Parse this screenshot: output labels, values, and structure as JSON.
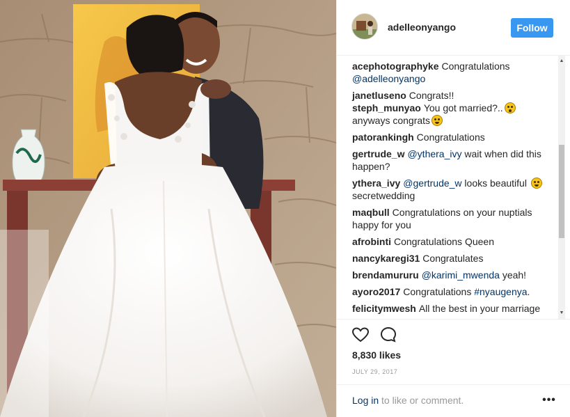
{
  "post": {
    "username": "adelleonyango",
    "follow_label": "Follow",
    "likes": "8,830 likes",
    "date": "JULY 29, 2017",
    "login_link": "Log in",
    "login_rest": " to like or comment.",
    "more_label": "•••"
  },
  "icons": {
    "like": "heart-icon",
    "comment": "comment-bubble-icon",
    "more": "ellipsis-icon"
  },
  "colors": {
    "follow_button": "#3897f0",
    "link": "#003569",
    "muted": "#999999",
    "text": "#262626"
  },
  "comments": [
    {
      "user": "acephotographyke",
      "parts": [
        {
          "t": "Congratulations "
        },
        {
          "t": "@adelleonyango",
          "m": true
        }
      ]
    },
    {
      "user": "janetluseno",
      "parts": [
        {
          "t": "Congrats!!"
        }
      ]
    },
    {
      "user": "steph_munyao",
      "parts": [
        {
          "t": "You got married?.."
        },
        {
          "e": "surprised"
        },
        {
          "t": " anyways congrats"
        },
        {
          "e": "grin"
        }
      ]
    },
    {
      "user": "patorankingh",
      "parts": [
        {
          "t": "Congratulations"
        }
      ]
    },
    {
      "user": "gertrude_w",
      "parts": [
        {
          "t": "@ythera_ivy",
          "m": true
        },
        {
          "t": " wait when did this happen?"
        }
      ]
    },
    {
      "user": "ythera_ivy",
      "parts": [
        {
          "t": "@gertrude_w",
          "m": true
        },
        {
          "t": " looks beautiful "
        },
        {
          "e": "grin"
        },
        {
          "t": " secretwedding"
        }
      ]
    },
    {
      "user": "maqbull",
      "parts": [
        {
          "t": "Congratulations on your nuptials happy for you"
        }
      ]
    },
    {
      "user": "afrobinti",
      "parts": [
        {
          "t": "Congratulations Queen"
        }
      ]
    },
    {
      "user": "nancykaregi31",
      "parts": [
        {
          "t": "Congratulates"
        }
      ]
    },
    {
      "user": "brendamururu",
      "parts": [
        {
          "t": "@karimi_mwenda",
          "m": true
        },
        {
          "t": " yeah!"
        }
      ]
    },
    {
      "user": "ayoro2017",
      "parts": [
        {
          "t": "Congratulations "
        },
        {
          "t": "#nyaugenya",
          "m": true
        },
        {
          "t": "."
        }
      ]
    },
    {
      "user": "felicitymwesh",
      "parts": [
        {
          "t": "All the best in your marriage"
        }
      ]
    }
  ]
}
